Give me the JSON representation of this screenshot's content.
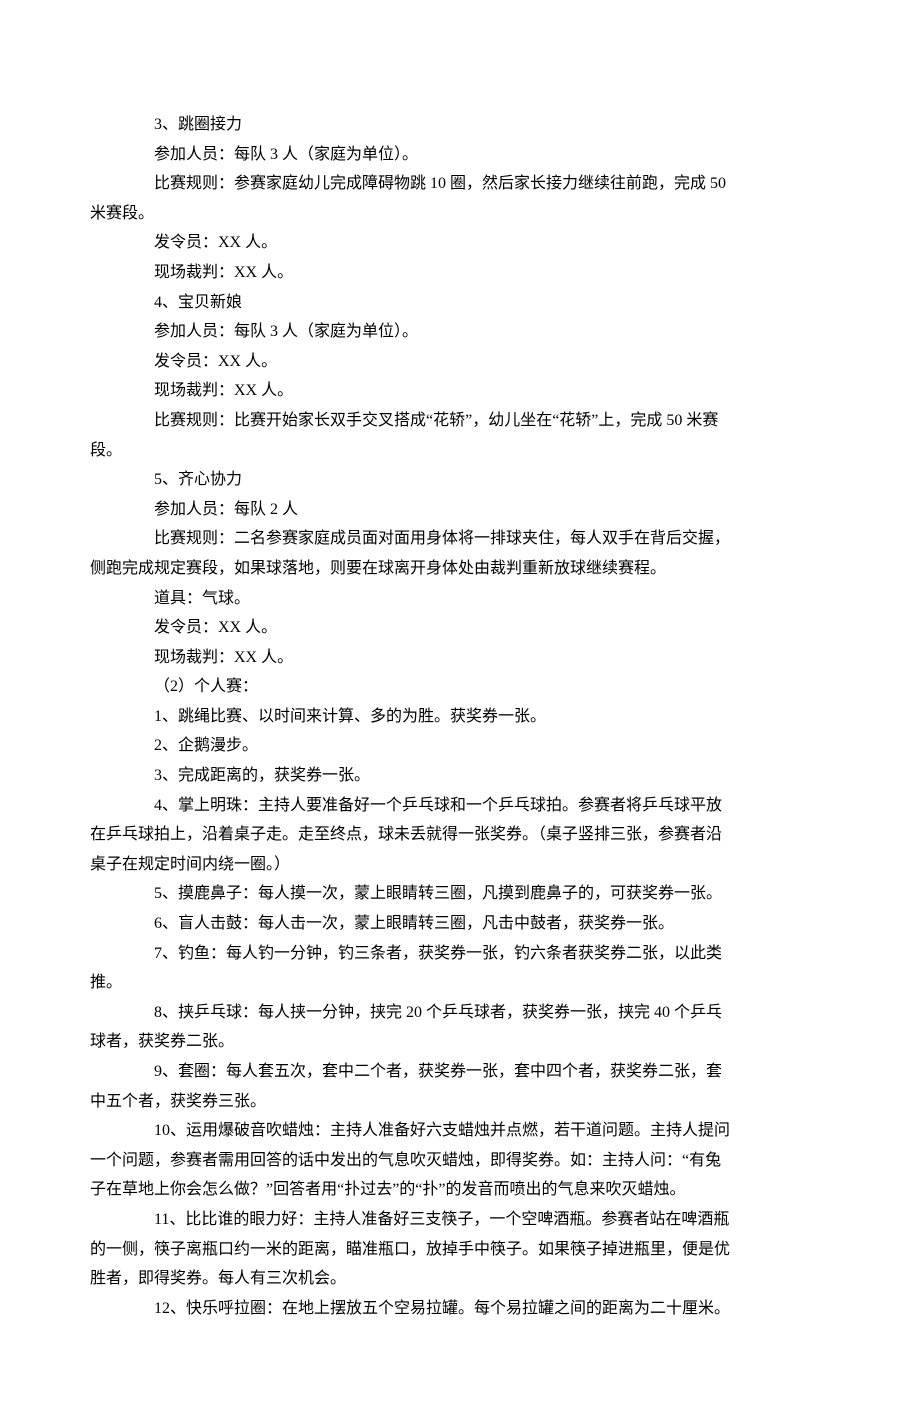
{
  "paragraphs": [
    {
      "type": "indent",
      "text": "3、跳圈接力"
    },
    {
      "type": "indent",
      "text": "参加人员：每队 3 人（家庭为单位）。"
    },
    {
      "type": "indent",
      "text": "比赛规则：参赛家庭幼儿完成障碍物跳 10 圈，然后家长接力继续往前跑，完成 50"
    },
    {
      "type": "continue",
      "text": "米赛段。"
    },
    {
      "type": "indent",
      "text": "发令员：XX 人。"
    },
    {
      "type": "indent",
      "text": "现场裁判：XX 人。"
    },
    {
      "type": "indent",
      "text": "4、宝贝新娘"
    },
    {
      "type": "indent",
      "text": "参加人员：每队 3 人（家庭为单位）。"
    },
    {
      "type": "indent",
      "text": "发令员：XX 人。"
    },
    {
      "type": "indent",
      "text": "现场裁判：XX 人。"
    },
    {
      "type": "indent",
      "text": "比赛规则：比赛开始家长双手交叉搭成“花轿”，幼儿坐在“花轿”上，完成 50 米赛"
    },
    {
      "type": "continue",
      "text": "段。"
    },
    {
      "type": "indent",
      "text": "5、齐心协力"
    },
    {
      "type": "indent",
      "text": "参加人员：每队 2 人"
    },
    {
      "type": "indent",
      "text": "比赛规则：二名参赛家庭成员面对面用身体将一排球夹住，每人双手在背后交握，"
    },
    {
      "type": "continue",
      "text": "侧跑完成规定赛段，如果球落地，则要在球离开身体处由裁判重新放球继续赛程。"
    },
    {
      "type": "indent",
      "text": "道具：气球。"
    },
    {
      "type": "indent",
      "text": "发令员：XX 人。"
    },
    {
      "type": "indent",
      "text": "现场裁判：XX 人。"
    },
    {
      "type": "indent",
      "text": "（2）个人赛："
    },
    {
      "type": "indent",
      "text": "1、跳绳比赛、以时间来计算、多的为胜。获奖券一张。"
    },
    {
      "type": "indent",
      "text": "2、企鹅漫步。"
    },
    {
      "type": "indent",
      "text": "3、完成距离的，获奖券一张。"
    },
    {
      "type": "indent",
      "text": "4、掌上明珠：主持人要准备好一个乒乓球和一个乒乓球拍。参赛者将乒乓球平放"
    },
    {
      "type": "continue",
      "text": "在乒乓球拍上，沿着桌子走。走至终点，球未丢就得一张奖券。（桌子竖排三张，参赛者沿"
    },
    {
      "type": "continue",
      "text": "桌子在规定时间内绕一圈。）"
    },
    {
      "type": "indent",
      "text": "5、摸鹿鼻子：每人摸一次，蒙上眼睛转三圈，凡摸到鹿鼻子的，可获奖券一张。"
    },
    {
      "type": "indent",
      "text": "6、盲人击鼓：每人击一次，蒙上眼睛转三圈，凡击中鼓者，获奖券一张。"
    },
    {
      "type": "indent",
      "text": "7、钓鱼：每人钓一分钟，钓三条者，获奖券一张，钓六条者获奖券二张，以此类"
    },
    {
      "type": "continue",
      "text": "推。"
    },
    {
      "type": "indent",
      "text": "8、挟乒乓球：每人挟一分钟，挟完 20 个乒乓球者，获奖券一张，挟完 40 个乒乓"
    },
    {
      "type": "continue",
      "text": "球者，获奖券二张。"
    },
    {
      "type": "indent",
      "text": "9、套圈：每人套五次，套中二个者，获奖券一张，套中四个者，获奖券二张，套"
    },
    {
      "type": "continue",
      "text": "中五个者，获奖券三张。"
    },
    {
      "type": "indent",
      "text": "10、运用爆破音吹蜡烛：主持人准备好六支蜡烛并点燃，若干道问题。主持人提问"
    },
    {
      "type": "continue",
      "text": "一个问题，参赛者需用回答的话中发出的气息吹灭蜡烛，即得奖券。如：主持人问：“有兔"
    },
    {
      "type": "continue",
      "text": "子在草地上你会怎么做？”回答者用“扑过去”的“扑”的发音而喷出的气息来吹灭蜡烛。"
    },
    {
      "type": "indent",
      "text": "11、比比谁的眼力好：主持人准备好三支筷子，一个空啤酒瓶。参赛者站在啤酒瓶"
    },
    {
      "type": "continue",
      "text": "的一侧，筷子离瓶口约一米的距离，瞄准瓶口，放掉手中筷子。如果筷子掉进瓶里，便是优"
    },
    {
      "type": "continue",
      "text": "胜者，即得奖券。每人有三次机会。"
    },
    {
      "type": "indent",
      "text": "12、快乐呼拉圈：在地上摆放五个空易拉罐。每个易拉罐之间的距离为二十厘米。"
    }
  ]
}
